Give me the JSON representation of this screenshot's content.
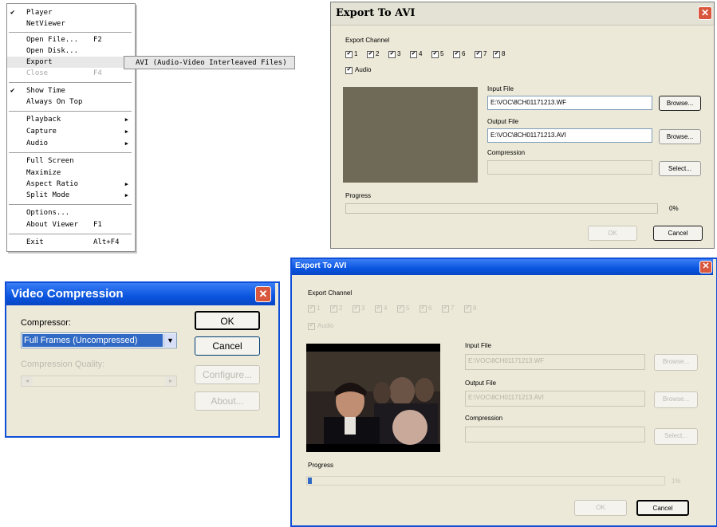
{
  "menu": {
    "items": [
      {
        "check": "✔",
        "label": "Player",
        "shortcut": "",
        "arrow": ""
      },
      {
        "check": "",
        "label": "NetViewer",
        "shortcut": "",
        "arrow": ""
      },
      {
        "check": "",
        "label": "Open File...",
        "shortcut": "F2",
        "arrow": ""
      },
      {
        "check": "",
        "label": "Open Disk...",
        "shortcut": "",
        "arrow": ""
      },
      {
        "check": "",
        "label": "Export",
        "shortcut": "",
        "arrow": "▶"
      },
      {
        "check": "",
        "label": "Close",
        "shortcut": "F4",
        "arrow": ""
      },
      {
        "check": "✔",
        "label": "Show Time",
        "shortcut": "",
        "arrow": ""
      },
      {
        "check": "",
        "label": "Always On Top",
        "shortcut": "",
        "arrow": ""
      },
      {
        "check": "",
        "label": "Playback",
        "shortcut": "",
        "arrow": "▶"
      },
      {
        "check": "",
        "label": "Capture",
        "shortcut": "",
        "arrow": "▶"
      },
      {
        "check": "",
        "label": "Audio",
        "shortcut": "",
        "arrow": "▶"
      },
      {
        "check": "",
        "label": "Full Screen",
        "shortcut": "",
        "arrow": ""
      },
      {
        "check": "",
        "label": "Maximize",
        "shortcut": "",
        "arrow": ""
      },
      {
        "check": "",
        "label": "Aspect Ratio",
        "shortcut": "",
        "arrow": "▶"
      },
      {
        "check": "",
        "label": "Split Mode",
        "shortcut": "",
        "arrow": "▶"
      },
      {
        "check": "",
        "label": "Options...",
        "shortcut": "",
        "arrow": ""
      },
      {
        "check": "",
        "label": "About Viewer",
        "shortcut": "F1",
        "arrow": ""
      },
      {
        "check": "",
        "label": "Exit",
        "shortcut": "Alt+F4",
        "arrow": ""
      }
    ],
    "submenu_label": "AVI (Audio-Video Interleaved Files)"
  },
  "export1": {
    "title": "Export To AVI",
    "close": "✕",
    "channel_label": "Export Channel",
    "channels": [
      "1",
      "2",
      "3",
      "4",
      "5",
      "6",
      "7",
      "8"
    ],
    "check": "✔",
    "audio_label": "Audio",
    "input_label": "Input File",
    "input_value": "E:\\VOC\\8CH01171213.WF",
    "output_label": "Output File",
    "output_value": "E:\\VOC\\8CH01171213.AVI",
    "compression_label": "Compression",
    "compression_value": "",
    "browse": "Browse...",
    "select": "Select...",
    "progress_label": "Progress",
    "progress_text": "0%",
    "progress": 0,
    "ok": "OK",
    "cancel": "Cancel"
  },
  "vc": {
    "title": "Video Compression",
    "close": "✕",
    "compressor_label": "Compressor:",
    "compressor_value": "Full Frames (Uncompressed)",
    "dropdown_arrow": "▼",
    "quality_label": "Compression Quality:",
    "ok": "OK",
    "cancel": "Cancel",
    "configure": "Configure...",
    "about": "About...",
    "left_arrow": "◂",
    "right_arrow": "▸"
  },
  "export2": {
    "title": "Export To AVI",
    "close": "✕",
    "channel_label": "Export Channel",
    "channels": [
      "1",
      "2",
      "3",
      "4",
      "5",
      "6",
      "7",
      "8"
    ],
    "check": "✔",
    "audio_label": "Audio",
    "input_label": "Input File",
    "input_value": "E:\\VOC\\8CH01171213.WF",
    "output_label": "Output File",
    "output_value": "E:\\VOC\\8CH01171213.AVI",
    "compression_label": "Compression",
    "browse": "Browse...",
    "select": "Select...",
    "progress_label": "Progress",
    "progress_text": "1%",
    "progress": 0.01,
    "ok": "OK",
    "cancel": "Cancel"
  }
}
